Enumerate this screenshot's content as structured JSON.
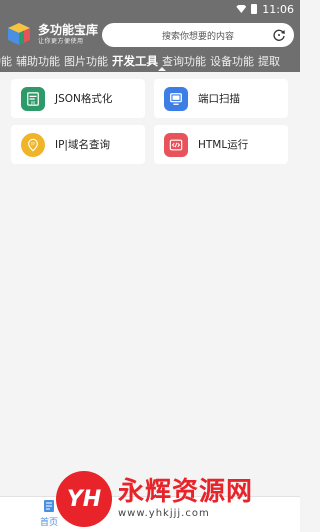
{
  "status": {
    "time": "11:06"
  },
  "header": {
    "app_name": "多功能宝库",
    "slogan": "让你更方便使用",
    "search_placeholder": "搜索你想要的内容"
  },
  "tabs": [
    {
      "label": "功能"
    },
    {
      "label": "辅助功能"
    },
    {
      "label": "图片功能"
    },
    {
      "label": "开发工具",
      "active": true
    },
    {
      "label": "查询功能"
    },
    {
      "label": "设备功能"
    },
    {
      "label": "提取"
    }
  ],
  "cards": [
    {
      "label": "JSON格式化",
      "icon": "json-document-icon",
      "color": "#2e9a6a"
    },
    {
      "label": "端口扫描",
      "icon": "monitor-icon",
      "color": "#3d7ee6"
    },
    {
      "label": "IP|域名查询",
      "icon": "location-pin-icon",
      "color": "#f0b429"
    },
    {
      "label": "HTML运行",
      "icon": "code-icon",
      "color": "#e8525a"
    }
  ],
  "bottom_nav": {
    "home_label": "首页",
    "accent": "#4a90e2"
  },
  "watermark": {
    "badge": "YH",
    "title": "永辉资源网",
    "url": "www.yhkjjj.com",
    "color": "#e8242a"
  }
}
